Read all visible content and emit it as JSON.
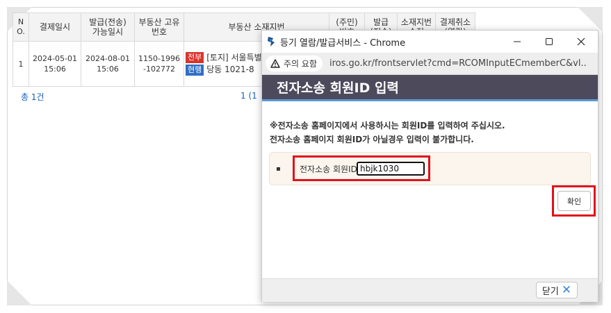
{
  "table": {
    "headers": [
      "N O.",
      "결제일시",
      "발급(전송) 가능일시",
      "부동산 고유번호",
      "부동산 소재지번",
      "(주민) 번호",
      "발급 (전송)",
      "소재지번 수정",
      "결제취소 (열람)"
    ],
    "rows": [
      {
        "no": "1",
        "payment_date": "2024-05-01",
        "payment_time": "15:06",
        "issue_date": "2024-08-01",
        "issue_time": "15:06",
        "property_id_1": "1150-1996",
        "property_id_2": "-102772",
        "tag1": "전부",
        "tag2": "현행",
        "address_1": "[토지] 서울특별",
        "address_2": "당동 1021-8"
      }
    ],
    "total": "총 1건",
    "pager": "1  (1"
  },
  "popup": {
    "title": "등기 열람/발급서비스 - Chrome",
    "warning": "주의 요함",
    "url": "iros.go.kr/frontservlet?cmd=RCOMInputECmemberC&vl...",
    "header": "전자소송 회원ID 입력",
    "notice_line1": "※전자소송 홈페이지에서 사용하시는 회원ID를 입력하여 주십시오.",
    "notice_line2": "전자소송 홈페이지 회원ID가 아닐경우 입력이 불가합니다.",
    "field_label": "전자소송 회원ID",
    "field_value": "hbjk1030",
    "confirm_label": "확인",
    "close_label": "닫기"
  },
  "colors": {
    "header_bg": "#4d4a5c",
    "header_underline": "#5b9bd5",
    "highlight": "#e0121c",
    "tag_red": "#d9342b",
    "tag_blue": "#2f6fc6"
  },
  "icons": [
    "app-icon",
    "minimize-icon",
    "maximize-icon",
    "close-icon",
    "warning-icon",
    "close-x-icon"
  ]
}
